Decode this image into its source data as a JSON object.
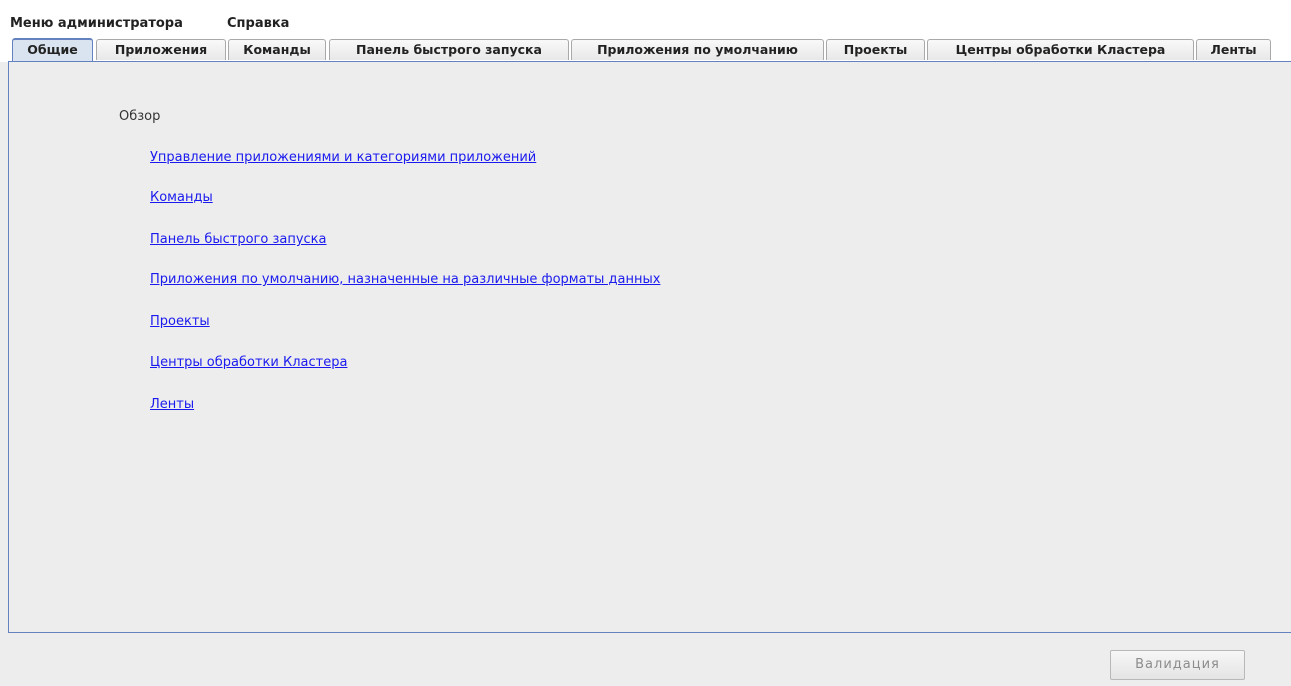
{
  "menubar": {
    "items": [
      {
        "label": "Меню администратора"
      },
      {
        "label": "Справка"
      }
    ]
  },
  "tabs": [
    {
      "label": "Общие",
      "active": true
    },
    {
      "label": "Приложения"
    },
    {
      "label": "Команды"
    },
    {
      "label": "Панель быстрого запуска"
    },
    {
      "label": "Приложения по умолчанию"
    },
    {
      "label": "Проекты"
    },
    {
      "label": "Центры обработки Кластера"
    },
    {
      "label": "Ленты"
    }
  ],
  "content": {
    "overview_label": "Обзор",
    "links": [
      {
        "label": "Управление приложениями и категориями приложений"
      },
      {
        "label": "Команды"
      },
      {
        "label": "Панель быстрого запуска"
      },
      {
        "label": "Приложения по умолчанию, назначенные на различные форматы данных"
      },
      {
        "label": "Проекты"
      },
      {
        "label": "Центры обработки Кластера"
      },
      {
        "label": "Ленты"
      }
    ]
  },
  "footer": {
    "validate_label": "Валидация",
    "validate_enabled": false
  },
  "colors": {
    "link": "#1a1aee",
    "active_tab_border": "#6382bf",
    "background": "#ededed"
  }
}
